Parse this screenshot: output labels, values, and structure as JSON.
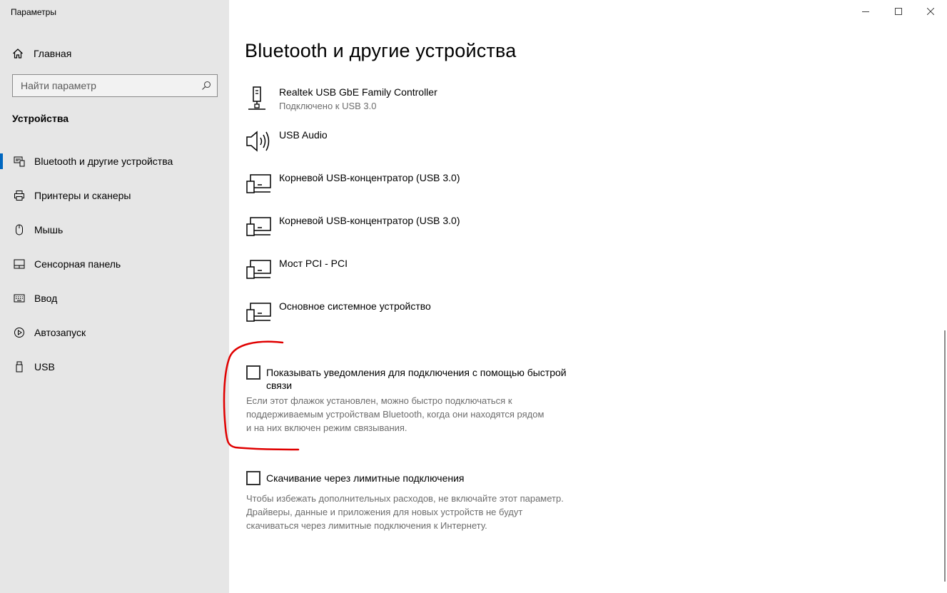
{
  "window": {
    "title": "Параметры",
    "controls": {
      "minimize": "minimize",
      "maximize": "maximize",
      "close": "close"
    }
  },
  "sidebar": {
    "home_label": "Главная",
    "search": {
      "placeholder": "Найти параметр",
      "value": ""
    },
    "section_title": "Устройства",
    "items": [
      {
        "label": "Bluetooth и другие устройства",
        "icon": "bluetooth-devices-icon",
        "active": true
      },
      {
        "label": "Принтеры и сканеры",
        "icon": "printer-icon",
        "active": false
      },
      {
        "label": "Мышь",
        "icon": "mouse-icon",
        "active": false
      },
      {
        "label": "Сенсорная панель",
        "icon": "touchpad-icon",
        "active": false
      },
      {
        "label": "Ввод",
        "icon": "keyboard-icon",
        "active": false
      },
      {
        "label": "Автозапуск",
        "icon": "autoplay-icon",
        "active": false
      },
      {
        "label": "USB",
        "icon": "usb-icon",
        "active": false
      }
    ]
  },
  "main": {
    "title": "Bluetooth и другие устройства",
    "devices": [
      {
        "name": "Realtek USB GbE Family Controller",
        "status": "Подключено к USB 3.0",
        "icon": "network-adapter-icon"
      },
      {
        "name": "USB Audio",
        "status": "",
        "icon": "speaker-icon"
      },
      {
        "name": "Корневой USB-концентратор (USB 3.0)",
        "status": "",
        "icon": "generic-device-icon"
      },
      {
        "name": "Корневой USB-концентратор (USB 3.0)",
        "status": "",
        "icon": "generic-device-icon"
      },
      {
        "name": "Мост PCI - PCI",
        "status": "",
        "icon": "generic-device-icon"
      },
      {
        "name": "Основное системное устройство",
        "status": "",
        "icon": "generic-device-icon"
      }
    ],
    "swift_pair": {
      "label": "Показывать уведомления для подключения с помощью быстрой связи",
      "checked": false,
      "description": "Если этот флажок установлен, можно быстро подключаться к поддерживаемым устройствам Bluetooth, когда они находятся рядом и на них включен режим связывания."
    },
    "metered": {
      "label": "Скачивание через лимитные подключения",
      "checked": false,
      "description": "Чтобы избежать дополнительных расходов, не включайте этот параметр. Драйверы, данные и приложения для новых устройств не будут скачиваться через лимитные подключения к Интернету."
    }
  },
  "colors": {
    "accent": "#0067c0",
    "annotation": "#e00000",
    "sidebar_bg": "#e6e6e6"
  }
}
